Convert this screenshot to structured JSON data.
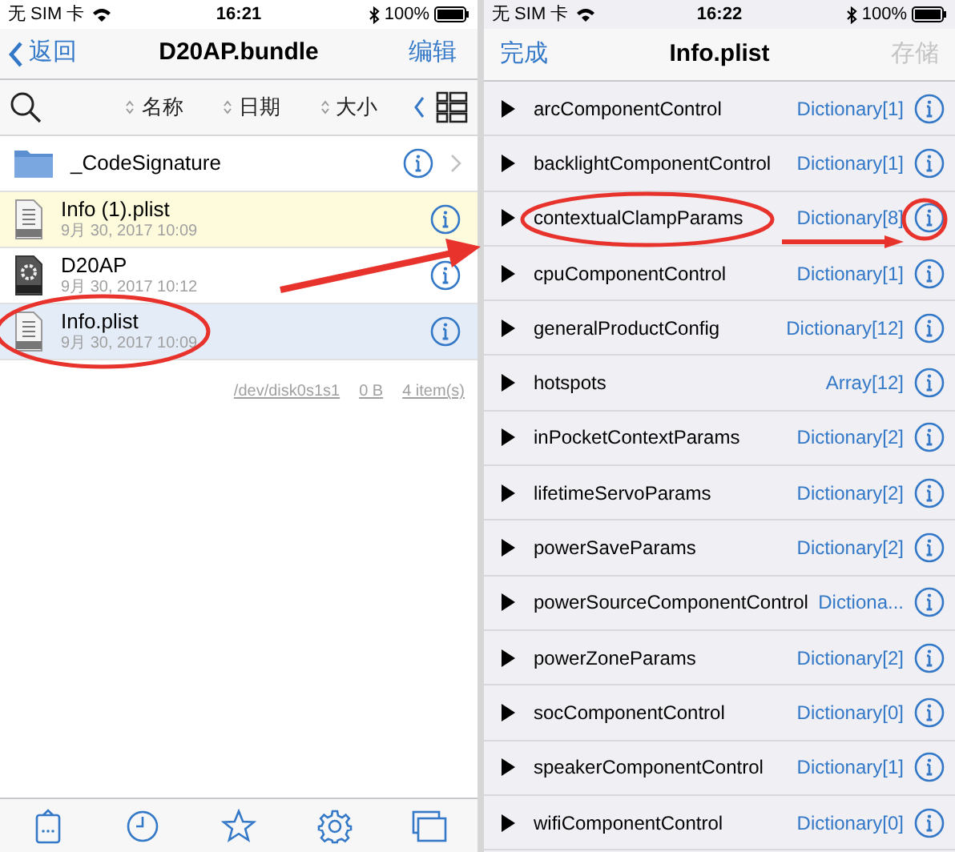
{
  "left": {
    "status_bar": {
      "carrier": "无 SIM 卡",
      "time": "16:21",
      "battery": "100%"
    },
    "nav": {
      "back": "返回",
      "title": "D20AP.bundle",
      "action": "编辑"
    },
    "sort_bar": {
      "columns": [
        {
          "label": "名称"
        },
        {
          "label": "日期"
        },
        {
          "label": "大小"
        }
      ]
    },
    "files": [
      {
        "kind": "folder",
        "name": "_CodeSignature",
        "selected": false,
        "flagged": false
      },
      {
        "kind": "plist",
        "name": "Info (1).plist",
        "date": "9月 30, 2017 10:09",
        "selected": false,
        "flagged": true
      },
      {
        "kind": "exec",
        "name": "D20AP",
        "date": "9月 30, 2017 10:12",
        "selected": false,
        "flagged": false
      },
      {
        "kind": "plist",
        "name": "Info.plist",
        "date": "9月 30, 2017 10:09",
        "selected": true,
        "flagged": false
      }
    ],
    "footer": [
      "/dev/disk0s1s1",
      "0 B",
      "4 item(s)"
    ]
  },
  "right": {
    "status_bar": {
      "carrier": "无 SIM 卡",
      "time": "16:22",
      "battery": "100%"
    },
    "nav": {
      "done": "完成",
      "title": "Info.plist",
      "save": "存储",
      "save_disabled": true
    },
    "entries": [
      {
        "key": "arcComponentControl",
        "type": "Dictionary[1]"
      },
      {
        "key": "backlightComponentControl",
        "type": "Dictionary[1]"
      },
      {
        "key": "contextualClampParams",
        "type": "Dictionary[8]"
      },
      {
        "key": "cpuComponentControl",
        "type": "Dictionary[1]"
      },
      {
        "key": "generalProductConfig",
        "type": "Dictionary[12]"
      },
      {
        "key": "hotspots",
        "type": "Array[12]"
      },
      {
        "key": "inPocketContextParams",
        "type": "Dictionary[2]"
      },
      {
        "key": "lifetimeServoParams",
        "type": "Dictionary[2]"
      },
      {
        "key": "powerSaveParams",
        "type": "Dictionary[2]"
      },
      {
        "key": "powerSourceComponentControl",
        "type": "Dictiona..."
      },
      {
        "key": "powerZoneParams",
        "type": "Dictionary[2]"
      },
      {
        "key": "socComponentControl",
        "type": "Dictionary[0]"
      },
      {
        "key": "speakerComponentControl",
        "type": "Dictionary[1]"
      },
      {
        "key": "wifiComponentControl",
        "type": "Dictionary[0]"
      }
    ]
  }
}
